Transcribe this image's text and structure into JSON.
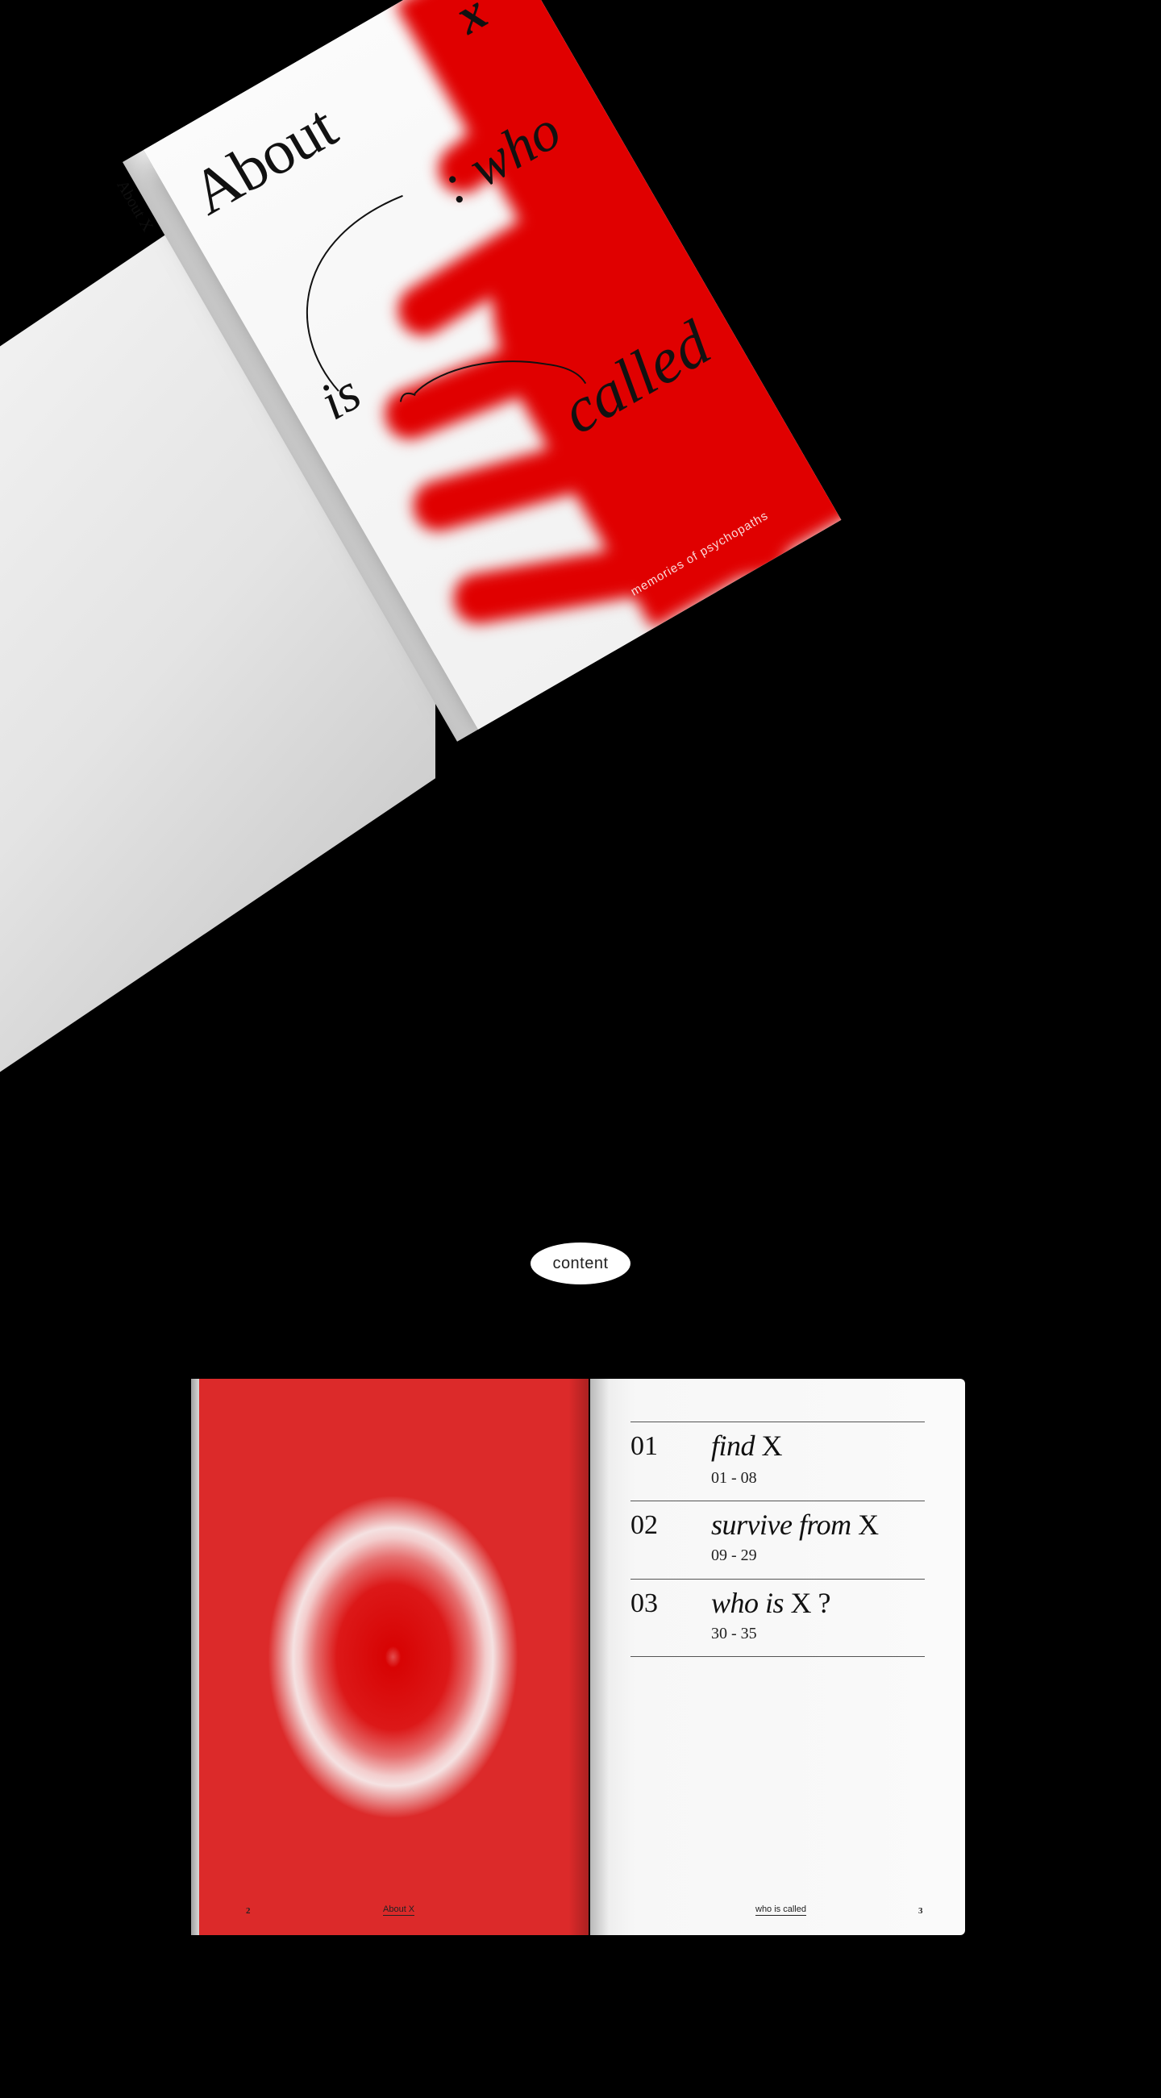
{
  "cover": {
    "title": "About",
    "x_mark": "x",
    "word_who": ": who",
    "word_is": "is",
    "word_called": "called",
    "subtitle": "memories of psychopaths",
    "spine_title": "About X"
  },
  "pill": {
    "label": "content"
  },
  "spread": {
    "left_folio_num": "2",
    "left_folio_label": "About X",
    "right_folio_label": "who is called",
    "right_folio_num": "3",
    "toc": [
      {
        "num": "01",
        "title_italic": "find",
        "title_plain": "X",
        "pages": "01 - 08"
      },
      {
        "num": "02",
        "title_italic": "survive from",
        "title_plain": "X",
        "pages": "09 - 29"
      },
      {
        "num": "03",
        "title_italic": "who is",
        "title_plain": "X ?",
        "pages": "30 - 35"
      }
    ]
  },
  "colors": {
    "accent_red": "#e00000",
    "background": "#000000",
    "paper": "#f5f5f5"
  }
}
